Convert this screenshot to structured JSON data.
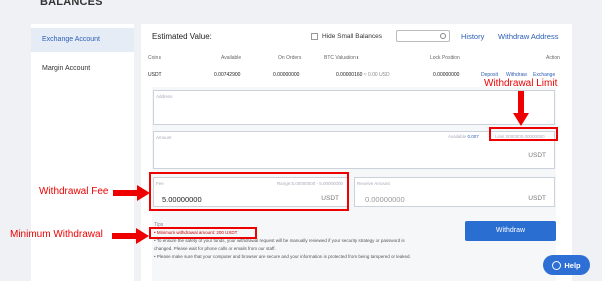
{
  "page": {
    "title": "BALANCES"
  },
  "sidebar": {
    "items": [
      {
        "label": "Exchange Account"
      },
      {
        "label": "Margin Account"
      }
    ]
  },
  "header": {
    "estimated_label": "Estimated Value:",
    "hide_small_label": "Hide Small Balances",
    "history_link": "History",
    "withdraw_address_link": "Withdraw Address"
  },
  "table": {
    "columns": [
      "Coin",
      "Available",
      "On Orders",
      "BTC Valuation",
      "Lock Position",
      "Action"
    ],
    "row": {
      "coin": "USDT",
      "available": "0.00742900",
      "on_orders": "0.00000000",
      "btc_valuation": "0.00000160",
      "usd_valuation": "≈ 0.00 USD",
      "lock_position": "0.00000000",
      "actions": [
        "Deposit",
        "Withdraw",
        "Exchange"
      ]
    }
  },
  "form": {
    "address_label": "Address",
    "amount_label": "Amount",
    "amount_unit": "USDT",
    "available_label": "Available",
    "available_value": "0.007",
    "limit_label": "Limit",
    "limit_value": "0000000.00000000",
    "fee_label": "Fee",
    "fee_range": "Range:5.00000000 - 5.00000000",
    "fee_value": "5.00000000",
    "fee_unit": "USDT",
    "receive_label": "Receive Amount",
    "receive_value": "0.00000000",
    "receive_unit": "USDT"
  },
  "tips": {
    "title": "Tips",
    "items": [
      "• Minimum withdrawal amount: 200 USDT",
      "• To ensure the safety of your funds, your withdrawal request will be manually reviewed if your security strategy or password is changed. Please wait for phone calls or emails from our staff.",
      "• Please make sure that your computer and browser are secure and your information is protected from being tampered or leaked."
    ]
  },
  "buttons": {
    "withdraw": "Withdraw",
    "help": "Help"
  },
  "annotations": {
    "withdrawal_limit": "Withdrawal Limit",
    "withdrawal_fee": "Withdrawal Fee",
    "minimum_withdrawal": "Minimum Withdrawal"
  },
  "colors": {
    "accent": "#2b6ed2",
    "annotation": "#e00000"
  }
}
